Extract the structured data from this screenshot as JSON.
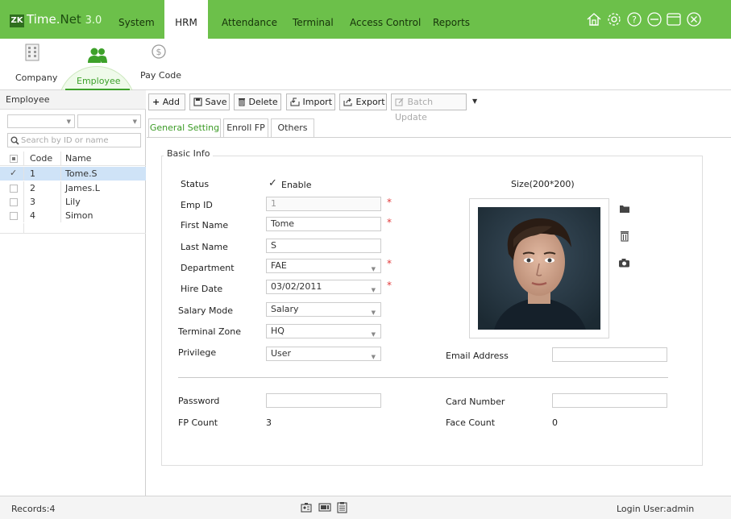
{
  "app": {
    "logo_mark": "ZK",
    "name_a": "Time.",
    "name_b": "Net",
    "version": "3.0"
  },
  "menu": [
    "System",
    "HRM",
    "Attendance",
    "Terminal",
    "Access Control",
    "Reports"
  ],
  "menu_active": "HRM",
  "top_icons": [
    "home-icon",
    "gear-icon",
    "help-icon",
    "minimize-icon",
    "maximize-icon",
    "close-icon"
  ],
  "ribbon": {
    "company": "Company",
    "employee": "Employee",
    "paycode": "Pay Code"
  },
  "left_panel": {
    "title": "Employee",
    "search_placeholder": "Search by ID or name",
    "columns": [
      "Code",
      "Name"
    ],
    "rows": [
      {
        "code": "1",
        "name": "Tome.S",
        "selected": true
      },
      {
        "code": "2",
        "name": "James.L",
        "selected": false
      },
      {
        "code": "3",
        "name": "Lily",
        "selected": false
      },
      {
        "code": "4",
        "name": "Simon",
        "selected": false
      }
    ]
  },
  "toolbar": {
    "add": "Add",
    "save": "Save",
    "delete": "Delete",
    "import": "Import",
    "export": "Export",
    "batch_update": "Batch Update"
  },
  "tabs": [
    "General Setting",
    "Enroll FP",
    "Others"
  ],
  "tab_active": "General Setting",
  "form": {
    "section": "Basic Info",
    "status_label": "Status",
    "status_value": "Enable",
    "emp_id_label": "Emp ID",
    "emp_id": "1",
    "first_name_label": "First Name",
    "first_name": "Tome",
    "last_name_label": "Last Name",
    "last_name": "S",
    "department_label": "Department",
    "department": "FAE",
    "hire_date_label": "Hire Date",
    "hire_date": "03/02/2011",
    "salary_mode_label": "Salary Mode",
    "salary_mode": "Salary",
    "terminal_zone_label": "Terminal Zone",
    "terminal_zone": "HQ",
    "privilege_label": "Privilege",
    "privilege": "User",
    "photo_size": "Size(200*200)",
    "email_label": "Email Address",
    "email": "",
    "password_label": "Password",
    "password": "",
    "card_label": "Card Number",
    "card": "",
    "fp_label": "FP Count",
    "fp_count": "3",
    "face_label": "Face Count",
    "face_count": "0"
  },
  "status_bar": {
    "records": "Records:4",
    "login": "Login User:admin"
  },
  "colors": {
    "brand_green": "#6cc04a",
    "required": "#e23b3b",
    "selected_row": "#cfe3f7"
  }
}
